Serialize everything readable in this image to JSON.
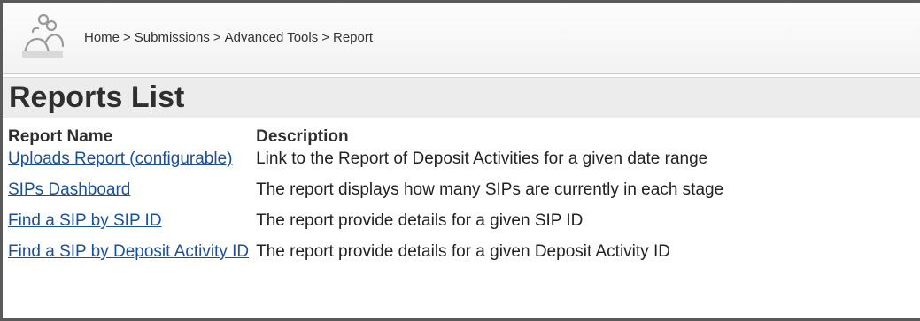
{
  "breadcrumb": {
    "items": [
      "Home",
      "Submissions",
      "Advanced Tools",
      "Report"
    ],
    "separator": ">"
  },
  "page": {
    "title": "Reports List"
  },
  "table": {
    "headers": {
      "name": "Report Name",
      "description": "Description"
    },
    "rows": [
      {
        "name": "Uploads Report (configurable)",
        "description": "Link to the Report of Deposit Activities for a given date range"
      },
      {
        "name": "SIPs Dashboard",
        "description": "The report displays how many SIPs are currently in each stage"
      },
      {
        "name": "Find a SIP by SIP ID",
        "description": "The report provide details for a given SIP ID"
      },
      {
        "name": "Find a SIP by Deposit Activity ID",
        "description": "The report provide details for a given Deposit Activity ID"
      }
    ]
  },
  "colors": {
    "link": "#1a4f9c",
    "title_bar": "#ececec",
    "frame": "#5a5a5a"
  },
  "icons": {
    "logo": "users-group-icon"
  }
}
